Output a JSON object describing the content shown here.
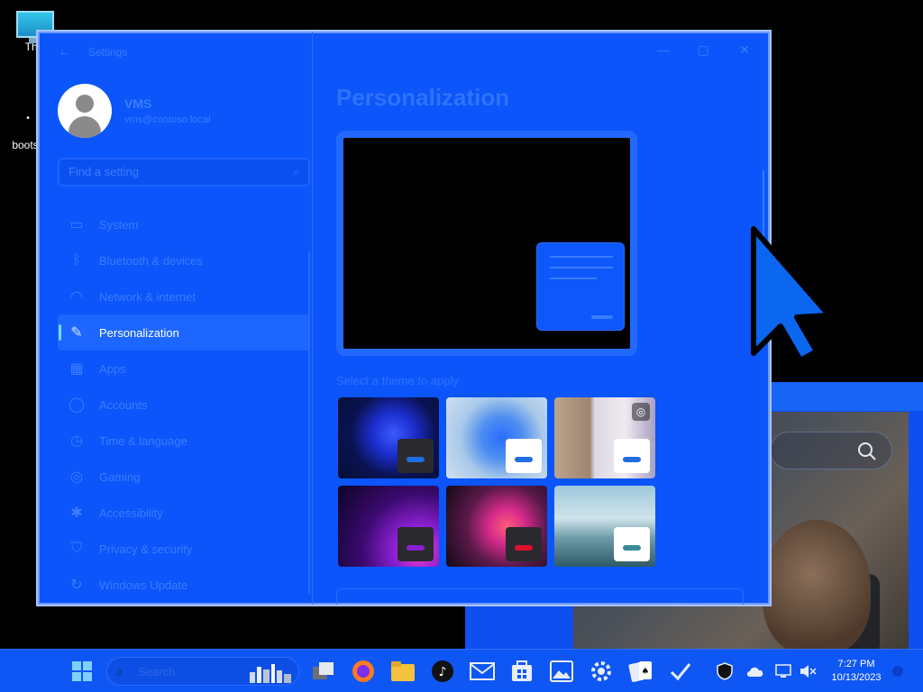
{
  "desktop": {
    "icons": [
      {
        "label": "This"
      },
      {
        "label": "bootsc"
      }
    ]
  },
  "settings": {
    "title": "Settings",
    "controls": {
      "minimize": "—",
      "maximize": "▢",
      "close": "✕"
    },
    "user": {
      "name": "VMS",
      "email": "vms@contoso.local"
    },
    "search": {
      "placeholder": "Find a setting"
    },
    "nav": [
      {
        "label": "System",
        "icon": "monitor-icon",
        "glyph": "▭"
      },
      {
        "label": "Bluetooth & devices",
        "icon": "bluetooth-icon",
        "glyph": "ᛒ"
      },
      {
        "label": "Network & internet",
        "icon": "wifi-icon",
        "glyph": "◠"
      },
      {
        "label": "Personalization",
        "icon": "brush-icon",
        "glyph": "✎",
        "active": true
      },
      {
        "label": "Apps",
        "icon": "apps-icon",
        "glyph": "▦"
      },
      {
        "label": "Accounts",
        "icon": "person-icon",
        "glyph": "◯"
      },
      {
        "label": "Time & language",
        "icon": "globe-clock-icon",
        "glyph": "◷"
      },
      {
        "label": "Gaming",
        "icon": "gamepad-icon",
        "glyph": "◎"
      },
      {
        "label": "Accessibility",
        "icon": "accessibility-icon",
        "glyph": "✱"
      },
      {
        "label": "Privacy & security",
        "icon": "shield-icon",
        "glyph": "⛉"
      },
      {
        "label": "Windows Update",
        "icon": "update-icon",
        "glyph": "↻"
      }
    ],
    "page": {
      "title": "Personalization",
      "theme_caption": "Select a theme to apply",
      "themes": [
        {
          "name": "windows-dark",
          "chip": "#2a2a2e",
          "bar": "#1f6fe0"
        },
        {
          "name": "windows-light",
          "chip": "#ffffff",
          "bar": "#1f6fe0"
        },
        {
          "name": "windows-spotlight",
          "chip": "#ffffff",
          "bar": "#1f6fe0",
          "badge": "◎"
        },
        {
          "name": "glow",
          "chip": "#2a2a2e",
          "bar": "#8a1fd0"
        },
        {
          "name": "captured-motion",
          "chip": "#2a2a2e",
          "bar": "#e0102a"
        },
        {
          "name": "flow",
          "chip": "#ffffff",
          "bar": "#3a8a9a"
        }
      ]
    }
  },
  "taskbar": {
    "search_placeholder": "Search",
    "apps": [
      "start-icon",
      "task-view-icon",
      "firefox-icon",
      "file-explorer-icon",
      "tiktok-icon",
      "mail-icon",
      "store-icon",
      "photos-icon",
      "settings-icon",
      "solitaire-icon",
      "todo-icon"
    ],
    "clock": {
      "time": "7:27 PM",
      "date": "10/13/2023"
    }
  }
}
